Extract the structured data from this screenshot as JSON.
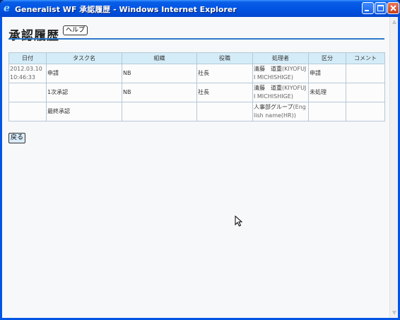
{
  "window": {
    "title": "Generalist WF 承認履歴 - Windows Internet Explorer",
    "app_icon": "ie-icon"
  },
  "page": {
    "heading": "承認履歴",
    "help_label": "ヘルプ",
    "back_label": "戻る"
  },
  "table": {
    "headers": [
      "日付",
      "タスク名",
      "組織",
      "役職",
      "処理者",
      "区分",
      "コメント"
    ],
    "rows": [
      {
        "date": "2012.03.10 10:46:33",
        "task": "申請",
        "org": "NB",
        "role": "社長",
        "handler": "清藤　道重",
        "handler_en": "(KIYOFUJI MICHISHIGE)",
        "status": "申請",
        "comment": ""
      },
      {
        "date": "",
        "task": "1次承認",
        "org": "NB",
        "role": "社長",
        "handler": "清藤　道重",
        "handler_en": "(KIYOFUJI MICHISHIGE)",
        "status": "未処理",
        "comment": ""
      },
      {
        "date": "",
        "task": "最終承認",
        "org": "",
        "role": "",
        "handler": "人事部グループ",
        "handler_en": "(English name(HR))",
        "status": "",
        "comment": ""
      }
    ]
  },
  "colors": {
    "titlebar": "#0054e3",
    "table_header": "#d4ecf8",
    "rule": "#2e7ac9"
  }
}
